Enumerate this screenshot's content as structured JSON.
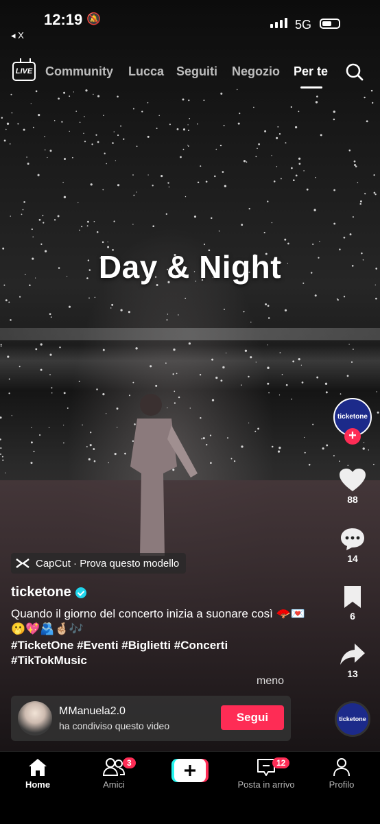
{
  "status_bar": {
    "time": "12:19",
    "network": "5G",
    "back_label": "◂ X"
  },
  "top_nav": {
    "live_label": "LIVE",
    "tabs": [
      {
        "label": "Community",
        "active": false
      },
      {
        "label": "Lucca",
        "active": false
      },
      {
        "label": "Seguiti",
        "active": false
      },
      {
        "label": "Negozio",
        "active": false
      },
      {
        "label": "Per te",
        "active": true
      }
    ]
  },
  "video": {
    "overlay_text": "Day & Night"
  },
  "side_rail": {
    "creator_avatar_text": "ticketone",
    "likes": "88",
    "comments": "14",
    "saves": "6",
    "shares": "13",
    "music_disc_text": "ticketone"
  },
  "capcut": {
    "label": "CapCut · Prova questo modello"
  },
  "post": {
    "author": "ticketone",
    "caption": "Quando il giorno del concerto inizia a suonare così 🪭💌🫢💖🫂🤞🏼🎶",
    "hashtags": "#TicketOne #Eventi #Biglietti #Concerti #TikTokMusic",
    "less_label": "meno"
  },
  "share_card": {
    "name": "MManuela2.0",
    "subtitle": "ha condiviso questo video",
    "follow_label": "Segui"
  },
  "bottom_nav": {
    "home": "Home",
    "friends": "Amici",
    "friends_badge": "3",
    "inbox": "Posta in arrivo",
    "inbox_badge": "12",
    "profile": "Profilo"
  },
  "colors": {
    "accent": "#fe2c55",
    "verified": "#20d5ec",
    "brand_blue": "#1c2a8a"
  }
}
